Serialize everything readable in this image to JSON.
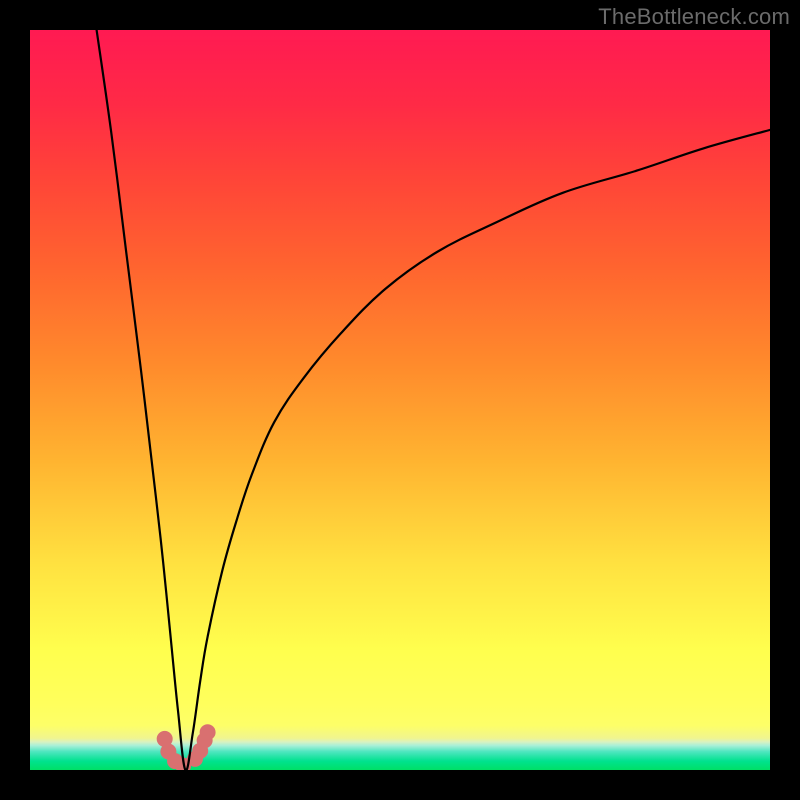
{
  "watermark": {
    "text": "TheBottleneck.com"
  },
  "chart_data": {
    "type": "line",
    "title": "",
    "xlabel": "",
    "ylabel": "",
    "xlim": [
      0,
      100
    ],
    "ylim": [
      0,
      100
    ],
    "note": "V-shaped bottleneck curve over vertical red→orange→yellow→green gradient. Minimum (zero bottleneck) at approximately x≈21. Left branch descends steeply from ~100% at x≈9 to 0% at x≈21. Right branch rises asymptotically toward ~87% as x→100. Small cluster of salmon-pink dot markers near the minimum.",
    "series": [
      {
        "name": "bottleneck_curve",
        "x": [
          9,
          11,
          13,
          15,
          17,
          18,
          19,
          20,
          21,
          22,
          23,
          24,
          26,
          28,
          30,
          33,
          37,
          42,
          48,
          55,
          63,
          72,
          82,
          91,
          100
        ],
        "values": [
          100,
          86,
          70,
          54,
          37,
          28,
          18,
          8,
          0,
          5,
          12,
          18,
          27,
          34,
          40,
          47,
          53,
          59,
          65,
          70,
          74,
          78,
          81,
          84,
          86.5
        ],
        "stroke": "#000000",
        "stroke_width": 2.2
      }
    ],
    "markers": [
      {
        "x": 18.2,
        "y": 4.2
      },
      {
        "x": 18.7,
        "y": 2.5
      },
      {
        "x": 19.6,
        "y": 1.2
      },
      {
        "x": 20.7,
        "y": 0.6
      },
      {
        "x": 22.3,
        "y": 1.5
      },
      {
        "x": 23.0,
        "y": 2.6
      },
      {
        "x": 23.6,
        "y": 4.0
      },
      {
        "x": 24.0,
        "y": 5.1
      }
    ],
    "marker_style": {
      "fill": "#d97070",
      "radius_px": 8
    },
    "gradient_stops": [
      {
        "pos": 0,
        "color": "#00e066"
      },
      {
        "pos": 5,
        "color": "#f0f590"
      },
      {
        "pos": 16,
        "color": "#ffff4e"
      },
      {
        "pos": 42,
        "color": "#ffb330"
      },
      {
        "pos": 68,
        "color": "#ff642f"
      },
      {
        "pos": 100,
        "color": "#ff1a52"
      }
    ]
  }
}
